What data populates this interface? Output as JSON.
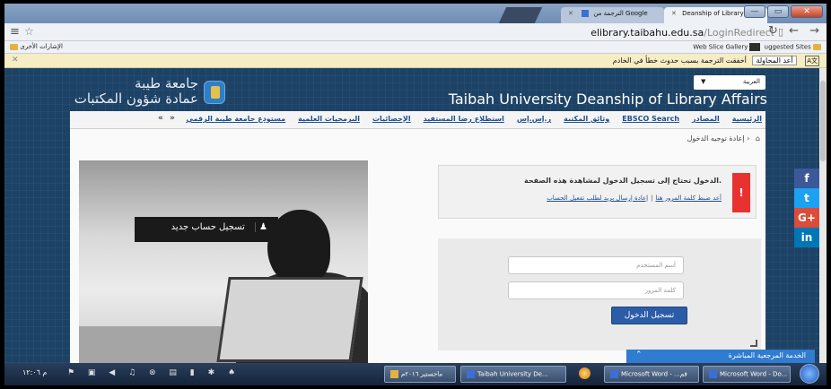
{
  "browser": {
    "tabs": [
      {
        "label": "الترجمة من Google"
      },
      {
        "label": "Deanship of Library Affairs"
      }
    ],
    "window_buttons": {
      "minimize": "—",
      "maximize": "▭",
      "close": "✕"
    },
    "url_domain": "elibrary.taibahu.edu.sa",
    "url_path": "/LoginRedirect",
    "nav_glyphs": "↻ ← →",
    "bookmarks_left": "الإشارات الأخرى",
    "bookmarks_right": [
      "Web Slice Gallery",
      "uggested Sites"
    ],
    "translate_message": "أخفقت الترجمة بسبب حدوث خطأ في الخادم",
    "translate_retry": "أعد المحاولة",
    "translate_close": "✕"
  },
  "header": {
    "university_name": "جامعة طيبة",
    "deanship_name": "عمادة شؤون المكتبات",
    "language_select": "العربية",
    "site_title": "Taibah University Deanship of Library Affairs"
  },
  "nav": {
    "items": [
      "الرئيسية",
      "المصادر",
      "EBSCO Search",
      "وثائق المكتبة",
      "ر.إس.إس",
      "استطلاع رضا المستفيد",
      "الإحصائيات",
      "البرمجيات العلمية",
      "مستودع جامعة طيبة الرقمي"
    ],
    "more_arrows": "« »"
  },
  "breadcrumb": {
    "current": "إعادة توجيه الدخول",
    "separator": "›",
    "home_glyph": "⌂"
  },
  "register": {
    "label": "تسجيل حساب جديد",
    "icon": "user-icon"
  },
  "alert": {
    "message": "الدخول تحتاج إلى تسجيل الدخول لمشاهدة هذه الصفحة.",
    "link_reset_password": "أعد ضبط كلمة المرور هنا",
    "separator": "|",
    "link_resend_activation": "إعادة إرسال بريد لطلب تفعيل الحساب",
    "icon_glyph": "!"
  },
  "login": {
    "username_placeholder": "أسم المستخدم",
    "password_placeholder": "كلمة المرور",
    "submit_label": "تسجيل الدخول"
  },
  "social": {
    "facebook": "f",
    "twitter": "t",
    "googleplus": "G+",
    "linkedin": "in"
  },
  "live_help": {
    "label": "الخدمة المرجعية المباشرة",
    "chevron": "⌃"
  },
  "taskbar": {
    "tasks": [
      "Microsoft Word - Do...",
      "Microsoft Word - ...قم",
      "Taibah University De...",
      "ماجستير ٢٠١٦م"
    ],
    "clock": "م ١٢:٠٦"
  },
  "colors": {
    "page_bg": "#1c4266",
    "login_button": "#2b5ca7",
    "alert_red": "#e8322f",
    "live_help": "#2f7cd0"
  }
}
